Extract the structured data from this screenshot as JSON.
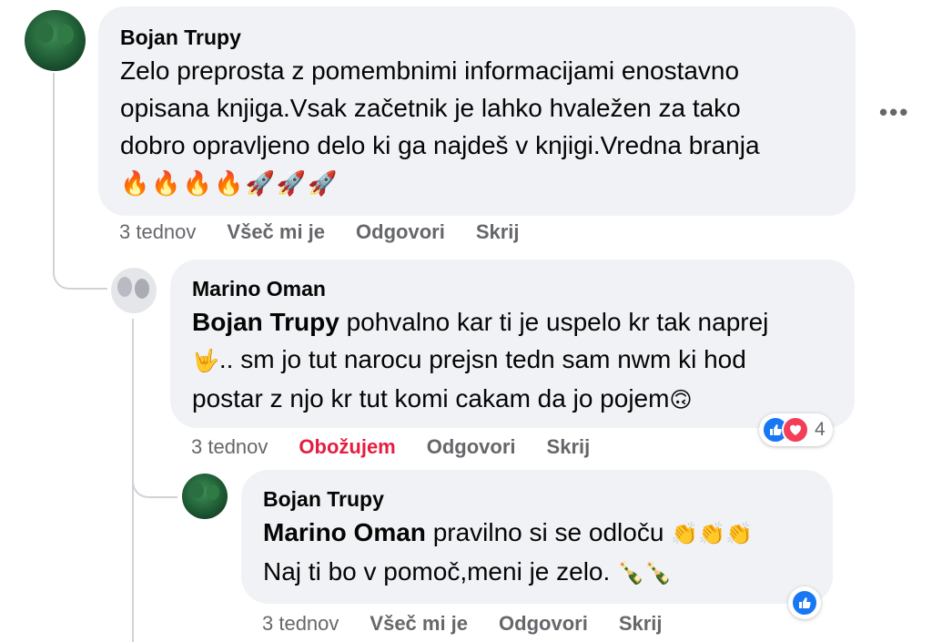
{
  "comments": [
    {
      "author": "Bojan Trupy",
      "text_line1": "Zelo preprosta z pomembnimi informacijami enostavno",
      "text_line2": "opisana knjiga.Vsak začetnik je lahko hvaležen za tako",
      "text_line3": "dobro opravljeno delo ki ga najdeš v knjigi.Vredna branja",
      "emojis": "🔥🔥🔥🔥🚀🚀🚀",
      "time": "3 tednov",
      "like_label": "Všeč mi je",
      "reply_label": "Odgovori",
      "hide_label": "Skrij",
      "more": "•••"
    },
    {
      "author": "Marino Oman",
      "mention": "Bojan Trupy",
      "text_line1": " pohvalno kar ti je uspelo kr tak naprej",
      "text_line2_emoji": "🤟",
      "text_line2": ".. sm jo tut narocu prejsn tedn sam nwm ki hod",
      "text_line3": "postar z njo kr tut komi cakam da jo pojem",
      "text_line3_emoji": "🙃",
      "time": "3 tednov",
      "like_label": "Obožujem",
      "reply_label": "Odgovori",
      "hide_label": "Skrij",
      "reaction_count": "4"
    },
    {
      "author": "Bojan Trupy",
      "mention": "Marino Oman",
      "text_line1": " pravilno si se odloču ",
      "text_line1_emoji": "👏👏👏",
      "text_line2": "Naj ti bo v pomoč,meni je zelo. ",
      "text_line2_emoji": "🍾🍾",
      "time": "3 tednov",
      "like_label": "Všeč mi je",
      "reply_label": "Odgovori",
      "hide_label": "Skrij"
    }
  ],
  "colors": {
    "bubble": "#f0f2f5",
    "meta": "#65676b",
    "love": "#e41e3f",
    "like_blue": "#1877f2",
    "heart_red": "#f33e58"
  }
}
